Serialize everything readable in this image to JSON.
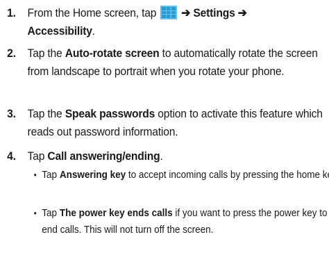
{
  "steps": [
    {
      "number": "1.",
      "p1": "From the Home screen, tap",
      "arrow1": "➔",
      "settings": "Settings",
      "arrow2": "➔",
      "accessibility": "Accessibility",
      "tail": "."
    },
    {
      "number": "2.",
      "pre": "Tap the",
      "bold": "Auto-rotate screen",
      "post": "to automatically rotate the screen from landscape to portrait when you rotate your phone."
    },
    {
      "number": "3.",
      "pre": "Tap the",
      "bold": "Speak passwords",
      "post": "option to activate this feature which reads out password information."
    },
    {
      "number": "4.",
      "pre": "Tap",
      "bold": "Call answering/ending",
      "post": ".",
      "subitems": [
        {
          "bullet": "•",
          "pre": "Tap",
          "bold": "Answering key",
          "post": "to accept incoming calls by pressing the home key."
        },
        {
          "bullet": "•",
          "pre": "Tap",
          "bold": "The power key ends calls",
          "post": "if you want to press the power key to end calls. This will not turn off the screen."
        }
      ]
    }
  ],
  "icons": {
    "apps": "apps-grid-icon"
  },
  "colors": {
    "icon_fill": "#2a9ad4",
    "icon_line": "#6ac1e6"
  }
}
